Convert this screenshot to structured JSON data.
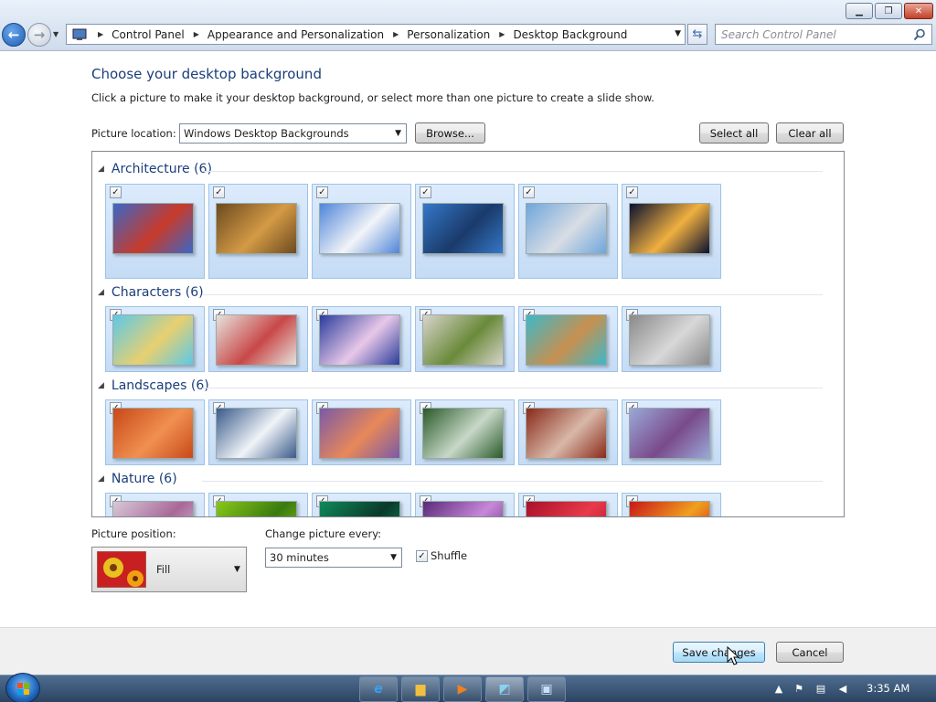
{
  "window": {
    "breadcrumbs": [
      "Control Panel",
      "Appearance and Personalization",
      "Personalization",
      "Desktop Background"
    ],
    "search_placeholder": "Search Control Panel"
  },
  "page": {
    "heading": "Choose your desktop background",
    "subheading": "Click a picture to make it your desktop background, or select more than one picture to create a slide show.",
    "picture_location_label": "Picture location:",
    "picture_location_value": "Windows Desktop Backgrounds",
    "browse_label": "Browse...",
    "select_all_label": "Select all",
    "clear_all_label": "Clear all"
  },
  "groups": [
    {
      "title": "Architecture (6)",
      "count": 6,
      "colors": [
        [
          "#3a67c8",
          "#c83a2a"
        ],
        [
          "#6b4a20",
          "#d49a45"
        ],
        [
          "#4f86d9",
          "#f2f4f8"
        ],
        [
          "#3578c8",
          "#1a3a6a"
        ],
        [
          "#6fa6dc",
          "#d8dde4"
        ],
        [
          "#0a1030",
          "#f0b040"
        ]
      ]
    },
    {
      "title": "Characters (6)",
      "count": 6,
      "colors": [
        [
          "#5cc8e8",
          "#e8d070"
        ],
        [
          "#e6e2dc",
          "#c84848"
        ],
        [
          "#2a3c9c",
          "#e8c8e8"
        ],
        [
          "#d8d4cc",
          "#6a8a3a"
        ],
        [
          "#3cb8c8",
          "#c89050"
        ],
        [
          "#8a8a8a",
          "#d8d8d8"
        ]
      ]
    },
    {
      "title": "Landscapes (6)",
      "count": 6,
      "colors": [
        [
          "#c84818",
          "#f09050"
        ],
        [
          "#3a5a8a",
          "#f0f4f8"
        ],
        [
          "#7a5aa8",
          "#e88858"
        ],
        [
          "#2a5a2a",
          "#c8d8c8"
        ],
        [
          "#8a2a1a",
          "#d8b8a8"
        ],
        [
          "#9aa8d8",
          "#7a4a8a"
        ]
      ]
    },
    {
      "title": "Nature (6)",
      "count": 6,
      "colors": [
        [
          "#d8c8d8",
          "#a86898"
        ],
        [
          "#8ac818",
          "#3a7a10"
        ],
        [
          "#108a5a",
          "#0a3a2a"
        ],
        [
          "#5a2a7a",
          "#c888d8"
        ],
        [
          "#a8102a",
          "#e83a4a"
        ],
        [
          "#c81818",
          "#f0a020"
        ]
      ]
    }
  ],
  "options": {
    "picture_position_label": "Picture position:",
    "picture_position_value": "Fill",
    "change_every_label": "Change picture every:",
    "change_every_value": "30 minutes",
    "shuffle_label": "Shuffle",
    "shuffle_checked": true
  },
  "footer": {
    "save_label": "Save changes",
    "cancel_label": "Cancel"
  },
  "taskbar": {
    "clock": "3:35 AM"
  }
}
